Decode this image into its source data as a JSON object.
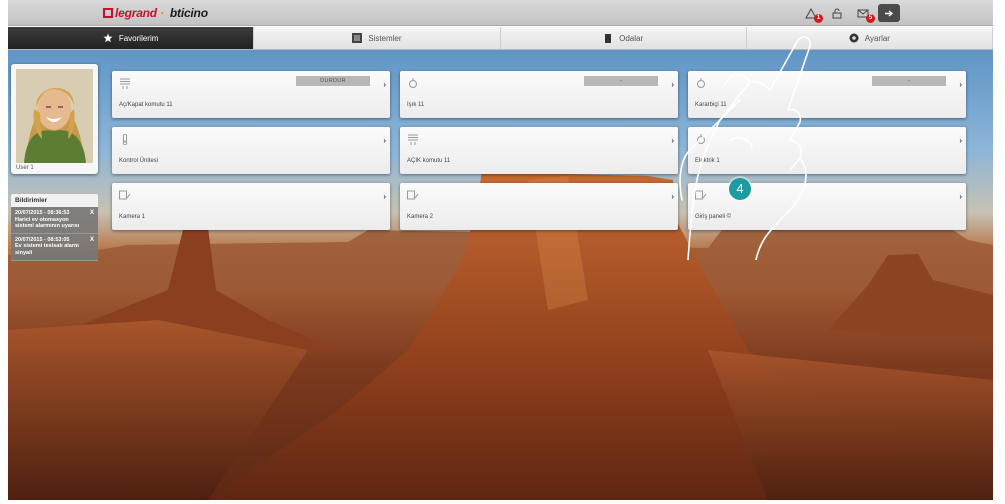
{
  "brand": {
    "legrand": "legrand",
    "bticino": "bticino"
  },
  "top_icons": [
    {
      "name": "alarm-icon",
      "badge": "1"
    },
    {
      "name": "lock-icon",
      "badge": ""
    },
    {
      "name": "mail-icon",
      "badge": "5"
    },
    {
      "name": "logout-icon",
      "badge": ""
    }
  ],
  "tabs": [
    {
      "label": "Favorilerim",
      "icon": "star-icon",
      "active": true
    },
    {
      "label": "Sistemler",
      "icon": "systems-icon",
      "active": false
    },
    {
      "label": "Odalar",
      "icon": "rooms-icon",
      "active": false
    },
    {
      "label": "Ayarlar",
      "icon": "settings-icon",
      "active": false
    }
  ],
  "user": {
    "name": "User 1"
  },
  "notifications": {
    "title": "Bildirimler",
    "items": [
      {
        "time": "20/07/2015 - 08:36:53",
        "text": "Harici ev otomasyon sistemi alarmının uyarısı"
      },
      {
        "time": "20/07/2015 - 08:53:05",
        "text": "Ev sistemi tesisatı alarm sinyali"
      }
    ],
    "close": "X"
  },
  "tiles": [
    {
      "label": "Aç/Kapat komutu 11",
      "icon": "shutter-icon",
      "control": "DURDUR"
    },
    {
      "label": "Işık 11",
      "icon": "light-icon",
      "control": "-"
    },
    {
      "label": "Kararbiçi 11",
      "icon": "dimmer-icon",
      "control": "-"
    },
    {
      "label": "Kontrol Ünitesi",
      "icon": "thermometer-icon",
      "control": ""
    },
    {
      "label": "AÇIK komutu 11",
      "icon": "shutter-icon",
      "control": ""
    },
    {
      "label": "Elektrik 1",
      "icon": "light-icon",
      "control": ""
    },
    {
      "label": "Kamera 1",
      "icon": "camera-icon",
      "control": ""
    },
    {
      "label": "Kamera 2",
      "icon": "camera-icon",
      "control": ""
    },
    {
      "label": "Giriş paneli ©",
      "icon": "camera-icon",
      "control": ""
    }
  ],
  "chevron": "›",
  "step_number": "4"
}
